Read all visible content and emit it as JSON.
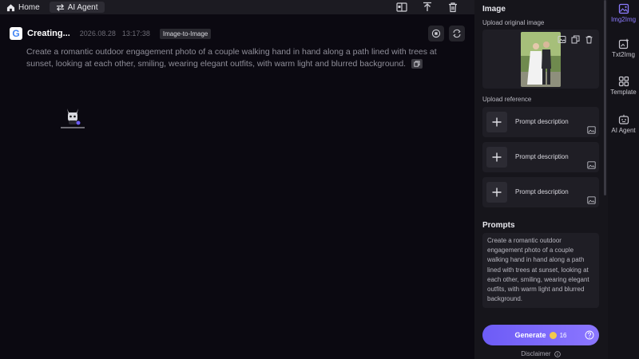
{
  "topbar": {
    "home_label": "Home",
    "agent_label": "AI Agent"
  },
  "task": {
    "title": "Creating...",
    "date": "2026.08.28",
    "time": "13:17:38",
    "badge": "Image-to-Image",
    "prompt": "Create a romantic outdoor engagement photo of a couple walking hand in hand along a path lined with trees at sunset, looking at each other, smiling, wearing elegant outfits, with warm light and blurred background."
  },
  "panel": {
    "image_title": "Image",
    "upload_original_label": "Upload original image",
    "upload_reference_label": "Upload reference",
    "references": [
      {
        "label": "Prompt description"
      },
      {
        "label": "Prompt description"
      },
      {
        "label": "Prompt description"
      }
    ],
    "prompts_title": "Prompts",
    "prompt_text": "Create a romantic outdoor engagement photo of a couple walking hand in hand along a path lined with trees at sunset, looking at each other, smiling, wearing elegant outfits, with warm light and blurred background.",
    "generate_label": "Generate",
    "generate_cost": "16",
    "disclaimer_label": "Disclaimer"
  },
  "rnav": {
    "items": [
      {
        "label": "Img2Img",
        "icon": "image-icon",
        "active": true
      },
      {
        "label": "Txt2Img",
        "icon": "text-image-icon",
        "active": false
      },
      {
        "label": "Template",
        "icon": "template-icon",
        "active": false
      },
      {
        "label": "AI Agent",
        "icon": "robot-icon",
        "active": false
      }
    ]
  },
  "colors": {
    "accent": "#7b68ff",
    "background": "#0b0911",
    "panel": "#16151b"
  }
}
